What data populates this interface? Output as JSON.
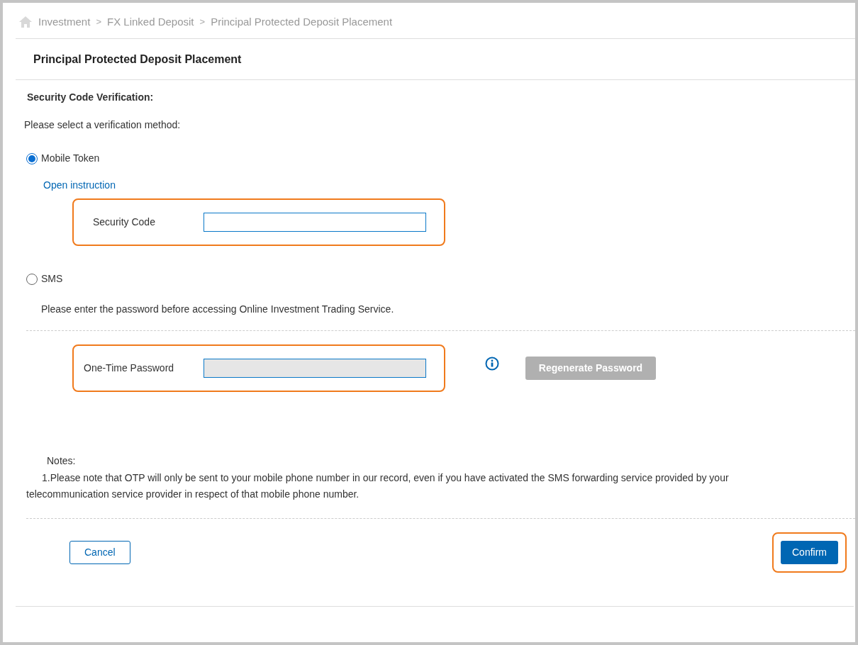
{
  "breadcrumb": {
    "items": [
      {
        "label": "Investment"
      },
      {
        "label": "FX Linked Deposit"
      },
      {
        "label": "Principal Protected Deposit Placement"
      }
    ],
    "separators": [
      ">",
      ">"
    ]
  },
  "title": "Principal Protected Deposit Placement",
  "section_title": "Security Code Verification:",
  "prompt": "Please select a verification method:",
  "methods": [
    {
      "kind": "token",
      "label": "Mobile Token",
      "selected": true,
      "link": "Open instruction",
      "field": {
        "label": "Security Code",
        "highlighted": true,
        "disabled": false
      }
    },
    {
      "kind": "sms",
      "label": "SMS",
      "selected": false,
      "message": "Please enter the password before accessing Online Investment Trading Service.",
      "field": {
        "label": "One-Time Password",
        "highlighted": true,
        "disabled": true
      },
      "regenerate": {
        "label": "Regenerate Password",
        "disabled": true
      }
    }
  ],
  "notes": {
    "title": "Notes:",
    "items": [
      "1.Please note that OTP will only be sent to your mobile phone number in our record, even if you have activated the SMS forwarding service provided by your telecommunication service provider in respect of that mobile phone number."
    ]
  },
  "buttons": {
    "cancel": {
      "label": "Cancel"
    },
    "confirm": {
      "label": "Confirm",
      "highlighted": true
    }
  }
}
